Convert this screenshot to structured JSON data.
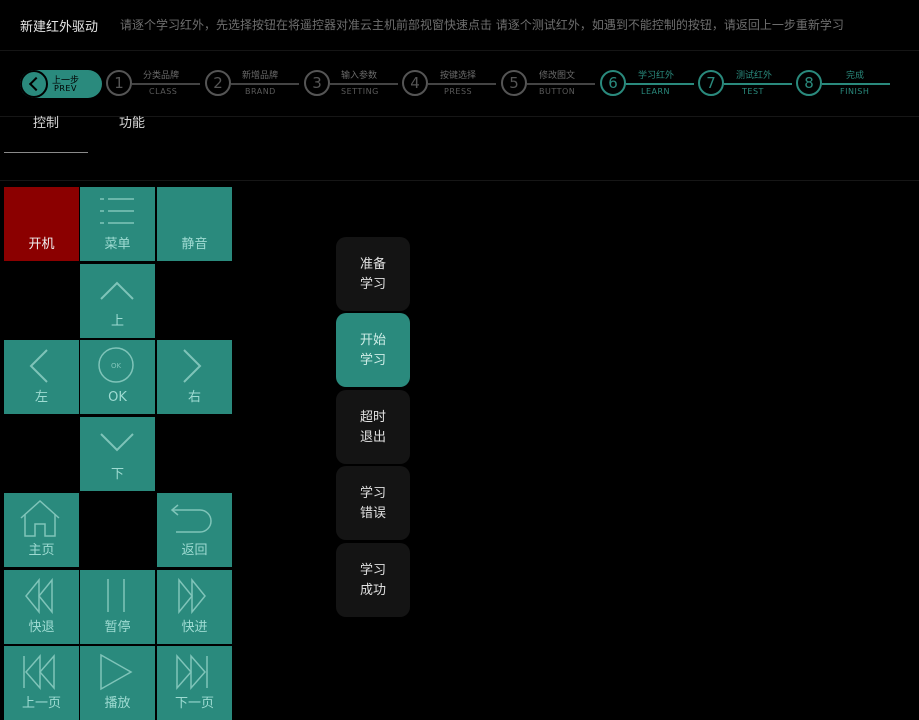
{
  "header": {
    "title": "新建红外驱动",
    "description": "请逐个学习红外，先选择按钮在将遥控器对准云主机前部视窗快速点击   请逐个测试红外，如遇到不能控制的按钮，请返回上一步重新学习"
  },
  "prev": {
    "cn": "上一步",
    "en": "PREV"
  },
  "steps": [
    {
      "num": "1",
      "cn": "分类品牌",
      "en": "CLASS"
    },
    {
      "num": "2",
      "cn": "新增品牌",
      "en": "BRAND"
    },
    {
      "num": "3",
      "cn": "输入参数",
      "en": "SETTING"
    },
    {
      "num": "4",
      "cn": "按键选择",
      "en": "PRESS"
    },
    {
      "num": "5",
      "cn": "修改图文",
      "en": "BUTTON"
    },
    {
      "num": "6",
      "cn": "学习红外",
      "en": "LEARN"
    },
    {
      "num": "7",
      "cn": "测试红外",
      "en": "TEST"
    },
    {
      "num": "8",
      "cn": "完成",
      "en": "FINISH"
    }
  ],
  "tabs": [
    "控制",
    "功能"
  ],
  "keys": {
    "power": "开机",
    "menu": "菜单",
    "mute": "静音",
    "up": "上",
    "left": "左",
    "ok": "OK",
    "right": "右",
    "down": "下",
    "home": "主页",
    "back": "返回",
    "rewind": "快退",
    "pause": "暂停",
    "forward": "快进",
    "prev_page": "上一页",
    "play": "播放",
    "next_page": "下一页"
  },
  "status": [
    {
      "line1": "准备",
      "line2": "学习"
    },
    {
      "line1": "开始",
      "line2": "学习"
    },
    {
      "line1": "超时",
      "line2": "退出"
    },
    {
      "line1": "学习",
      "line2": "错误"
    },
    {
      "line1": "学习",
      "line2": "成功"
    }
  ],
  "colors": {
    "accent": "#2a8a7d",
    "power": "#8b0000",
    "background": "#000000"
  },
  "icons": {
    "prev": "chevron-left-icon",
    "menu": "menu-icon",
    "up": "chevron-up-icon",
    "left": "chevron-left-icon",
    "ok": "ok-circle-icon",
    "right": "chevron-right-icon",
    "down": "chevron-down-icon",
    "home": "home-icon",
    "back": "return-icon",
    "rewind": "rewind-icon",
    "pause": "pause-icon",
    "forward": "fast-forward-icon",
    "prev_page": "skip-back-icon",
    "play": "play-icon",
    "next_page": "skip-forward-icon"
  }
}
